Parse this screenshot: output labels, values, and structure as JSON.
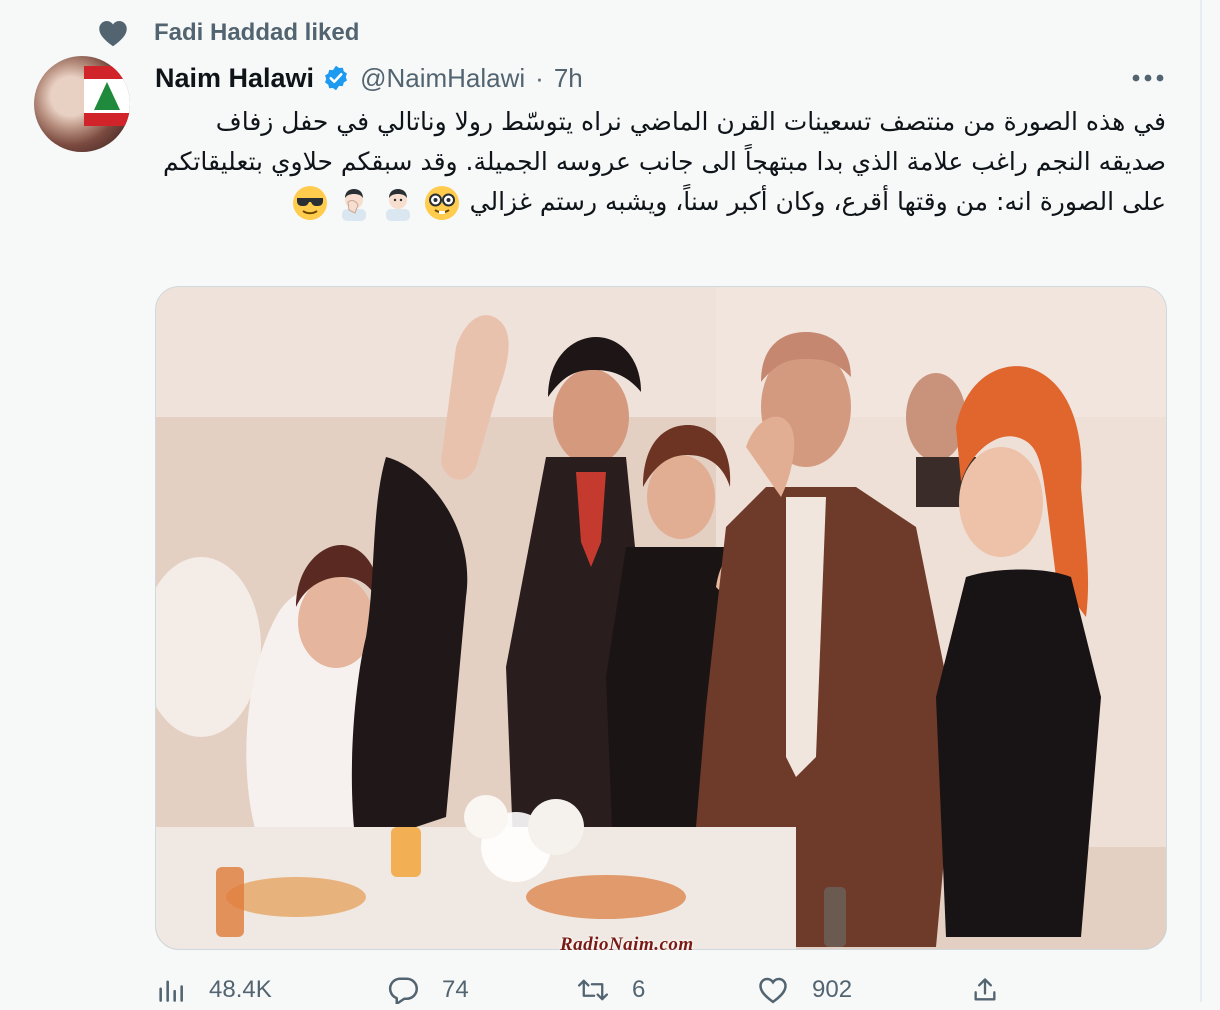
{
  "social_context": {
    "label": "Fadi Haddad liked",
    "icon": "heart-icon"
  },
  "author": {
    "name": "Naim Halawi",
    "handle": "@NaimHalawi",
    "separator": "·",
    "time": "7h",
    "verified": true
  },
  "more_icon": "more-horizontal-icon",
  "tweet": {
    "text": "في هذه الصورة من منتصف تسعينات القرن الماضي نراه يتوسّط رولا وناتالي في حفل زفاف صديقه النجم راغب علامة الذي بدا مبتهجاً الى جانب عروسه الجميلة. وقد سبقكم حلاوي بتعليقاتكم على الصورة انه: من وقتها أقرع، وكان أكبر سناً، ويشبه رستم غزالي",
    "emojis": [
      "nerd-face-emoji",
      "man-tipping-hand-emoji",
      "man-facepalming-emoji",
      "sunglasses-face-emoji"
    ]
  },
  "media": {
    "watermark": "RadioNaim.com"
  },
  "actions": {
    "views": {
      "icon": "analytics-icon",
      "count": "48.4K"
    },
    "reply": {
      "icon": "reply-icon",
      "count": "74"
    },
    "retweet": {
      "icon": "retweet-icon",
      "count": "6"
    },
    "like": {
      "icon": "heart-outline-icon",
      "count": "902"
    },
    "share": {
      "icon": "share-icon"
    }
  },
  "colors": {
    "text": "#0f1419",
    "secondary": "#536471",
    "verified": "#1d9bf0",
    "background": "#f7f9f9"
  }
}
